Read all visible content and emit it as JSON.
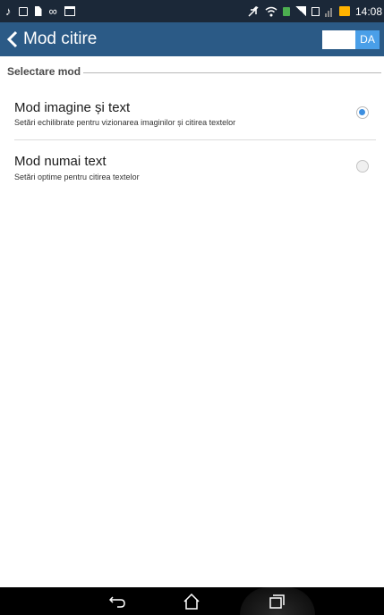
{
  "status_bar": {
    "time": "14:08",
    "icons": [
      "music-note-icon",
      "calendar-icon",
      "file-icon",
      "voicemail-icon",
      "window-icon",
      "mute-icon",
      "wifi-icon",
      "sim-icon",
      "signal-icon",
      "sim2-icon",
      "no-signal-icon",
      "battery-charging-icon"
    ]
  },
  "action_bar": {
    "title": "Mod citire",
    "toggle_label": "DA",
    "toggle_color": "#4a9fe8",
    "background": "#2b5a86"
  },
  "section": {
    "title": "Selectare mod"
  },
  "options": [
    {
      "title": "Mod imagine și text",
      "subtitle": "Setări echilibrate pentru vizionarea imaginilor și citirea textelor",
      "selected": true
    },
    {
      "title": "Mod numai text",
      "subtitle": "Setări optime pentru citirea textelor",
      "selected": false
    }
  ],
  "nav_bar": {
    "buttons": [
      "back-icon",
      "home-icon",
      "recents-icon"
    ]
  }
}
